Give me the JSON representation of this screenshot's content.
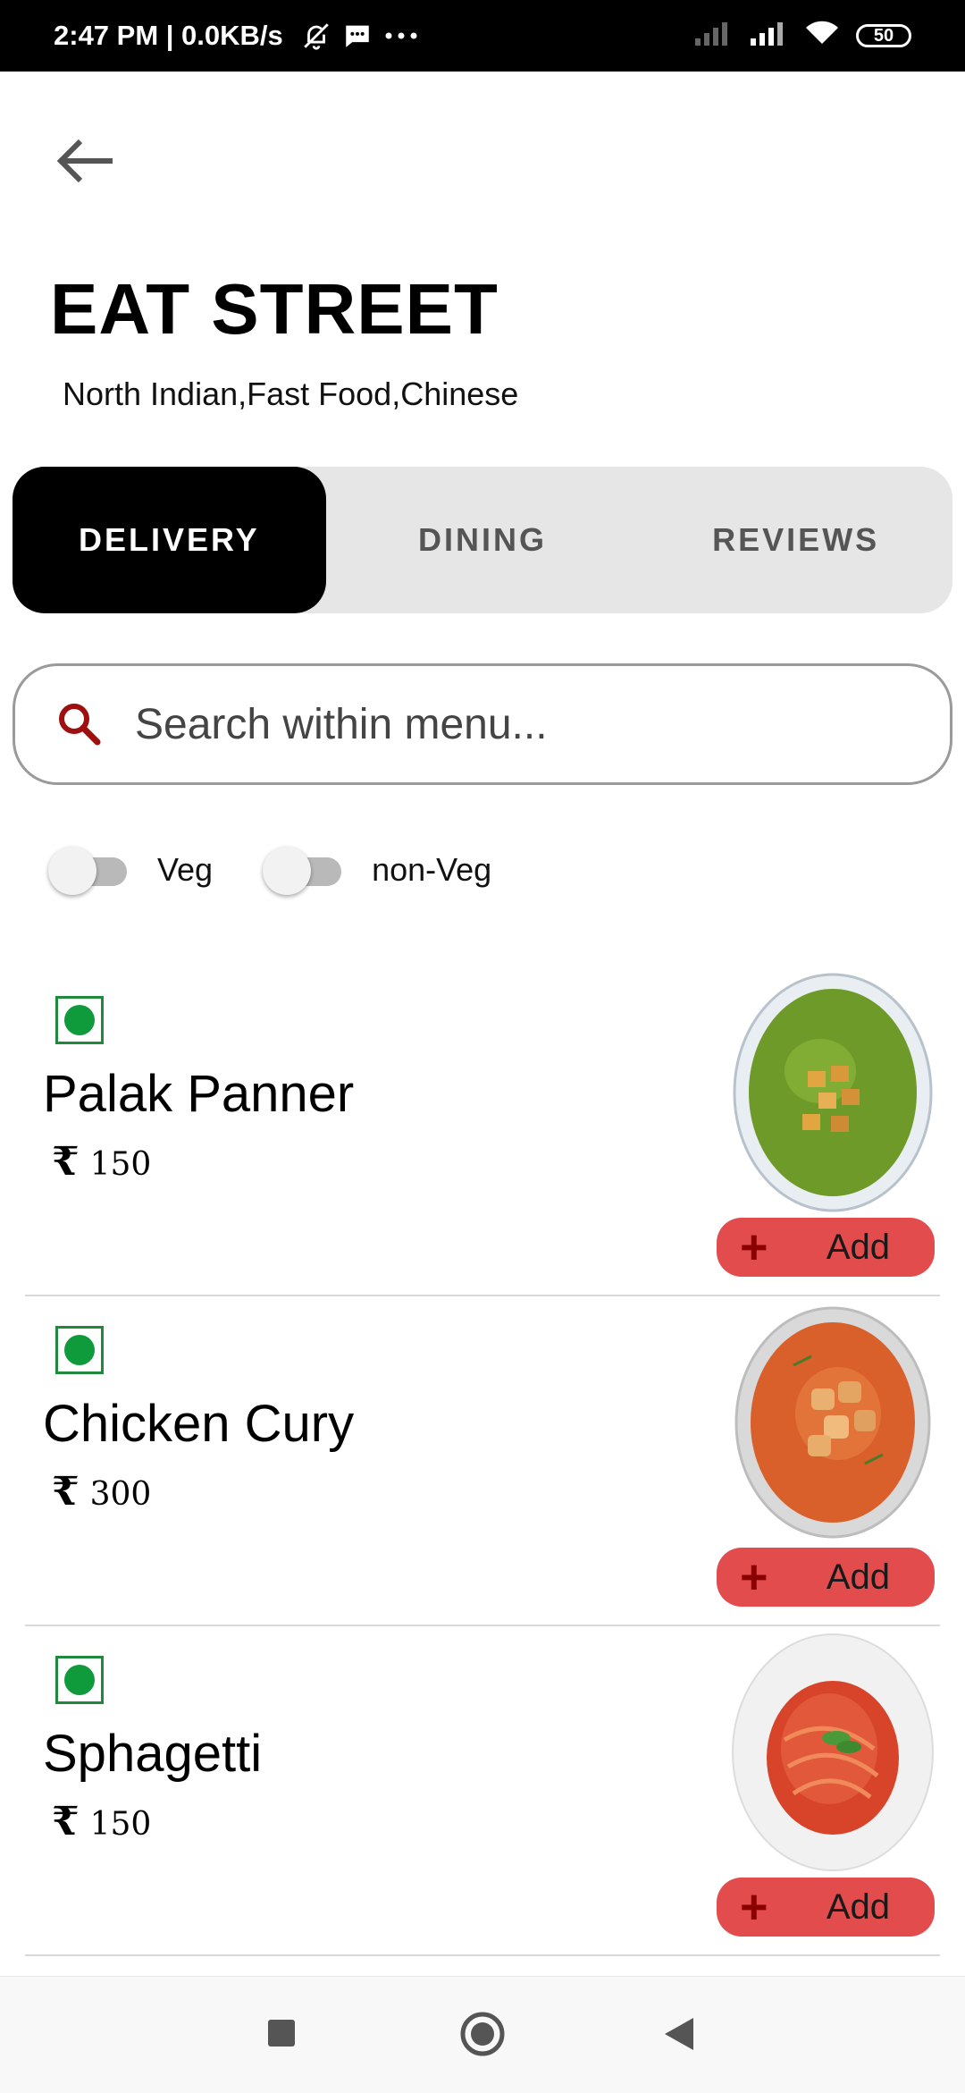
{
  "status_bar": {
    "time": "2:47 PM | 0.0KB/s",
    "battery": "50",
    "icons": [
      "bell-off-icon",
      "message-icon",
      "more-dots-icon",
      "signal-icon",
      "signal-icon",
      "wifi-icon",
      "battery-icon"
    ]
  },
  "restaurant": {
    "name": "EAT STREET",
    "cuisines": "North Indian,Fast Food,Chinese"
  },
  "tabs": [
    {
      "label": "DELIVERY",
      "active": true
    },
    {
      "label": "DINING",
      "active": false
    },
    {
      "label": "REVIEWS",
      "active": false
    }
  ],
  "search": {
    "placeholder": "Search within menu...",
    "value": ""
  },
  "filters": [
    {
      "label": "Veg",
      "on": false
    },
    {
      "label": "non-Veg",
      "on": false
    }
  ],
  "menu": [
    {
      "name": "Palak Panner",
      "currency": "₹",
      "price": "150",
      "type": "veg",
      "add_label": "Add",
      "image": "palak-paneer-bowl"
    },
    {
      "name": "Chicken Cury",
      "currency": "₹",
      "price": "300",
      "type": "veg",
      "add_label": "Add",
      "image": "chicken-curry-bowl"
    },
    {
      "name": "Sphagetti",
      "currency": "₹",
      "price": "150",
      "type": "veg",
      "add_label": "Add",
      "image": "spaghetti-plate"
    }
  ],
  "colors": {
    "accent_red": "#e24c4c",
    "veg_green": "#0f9a3c",
    "tab_active": "#000000",
    "tab_bg": "#e6e6e6"
  },
  "nav": [
    "recents-square-icon",
    "home-circle-icon",
    "back-triangle-icon"
  ]
}
